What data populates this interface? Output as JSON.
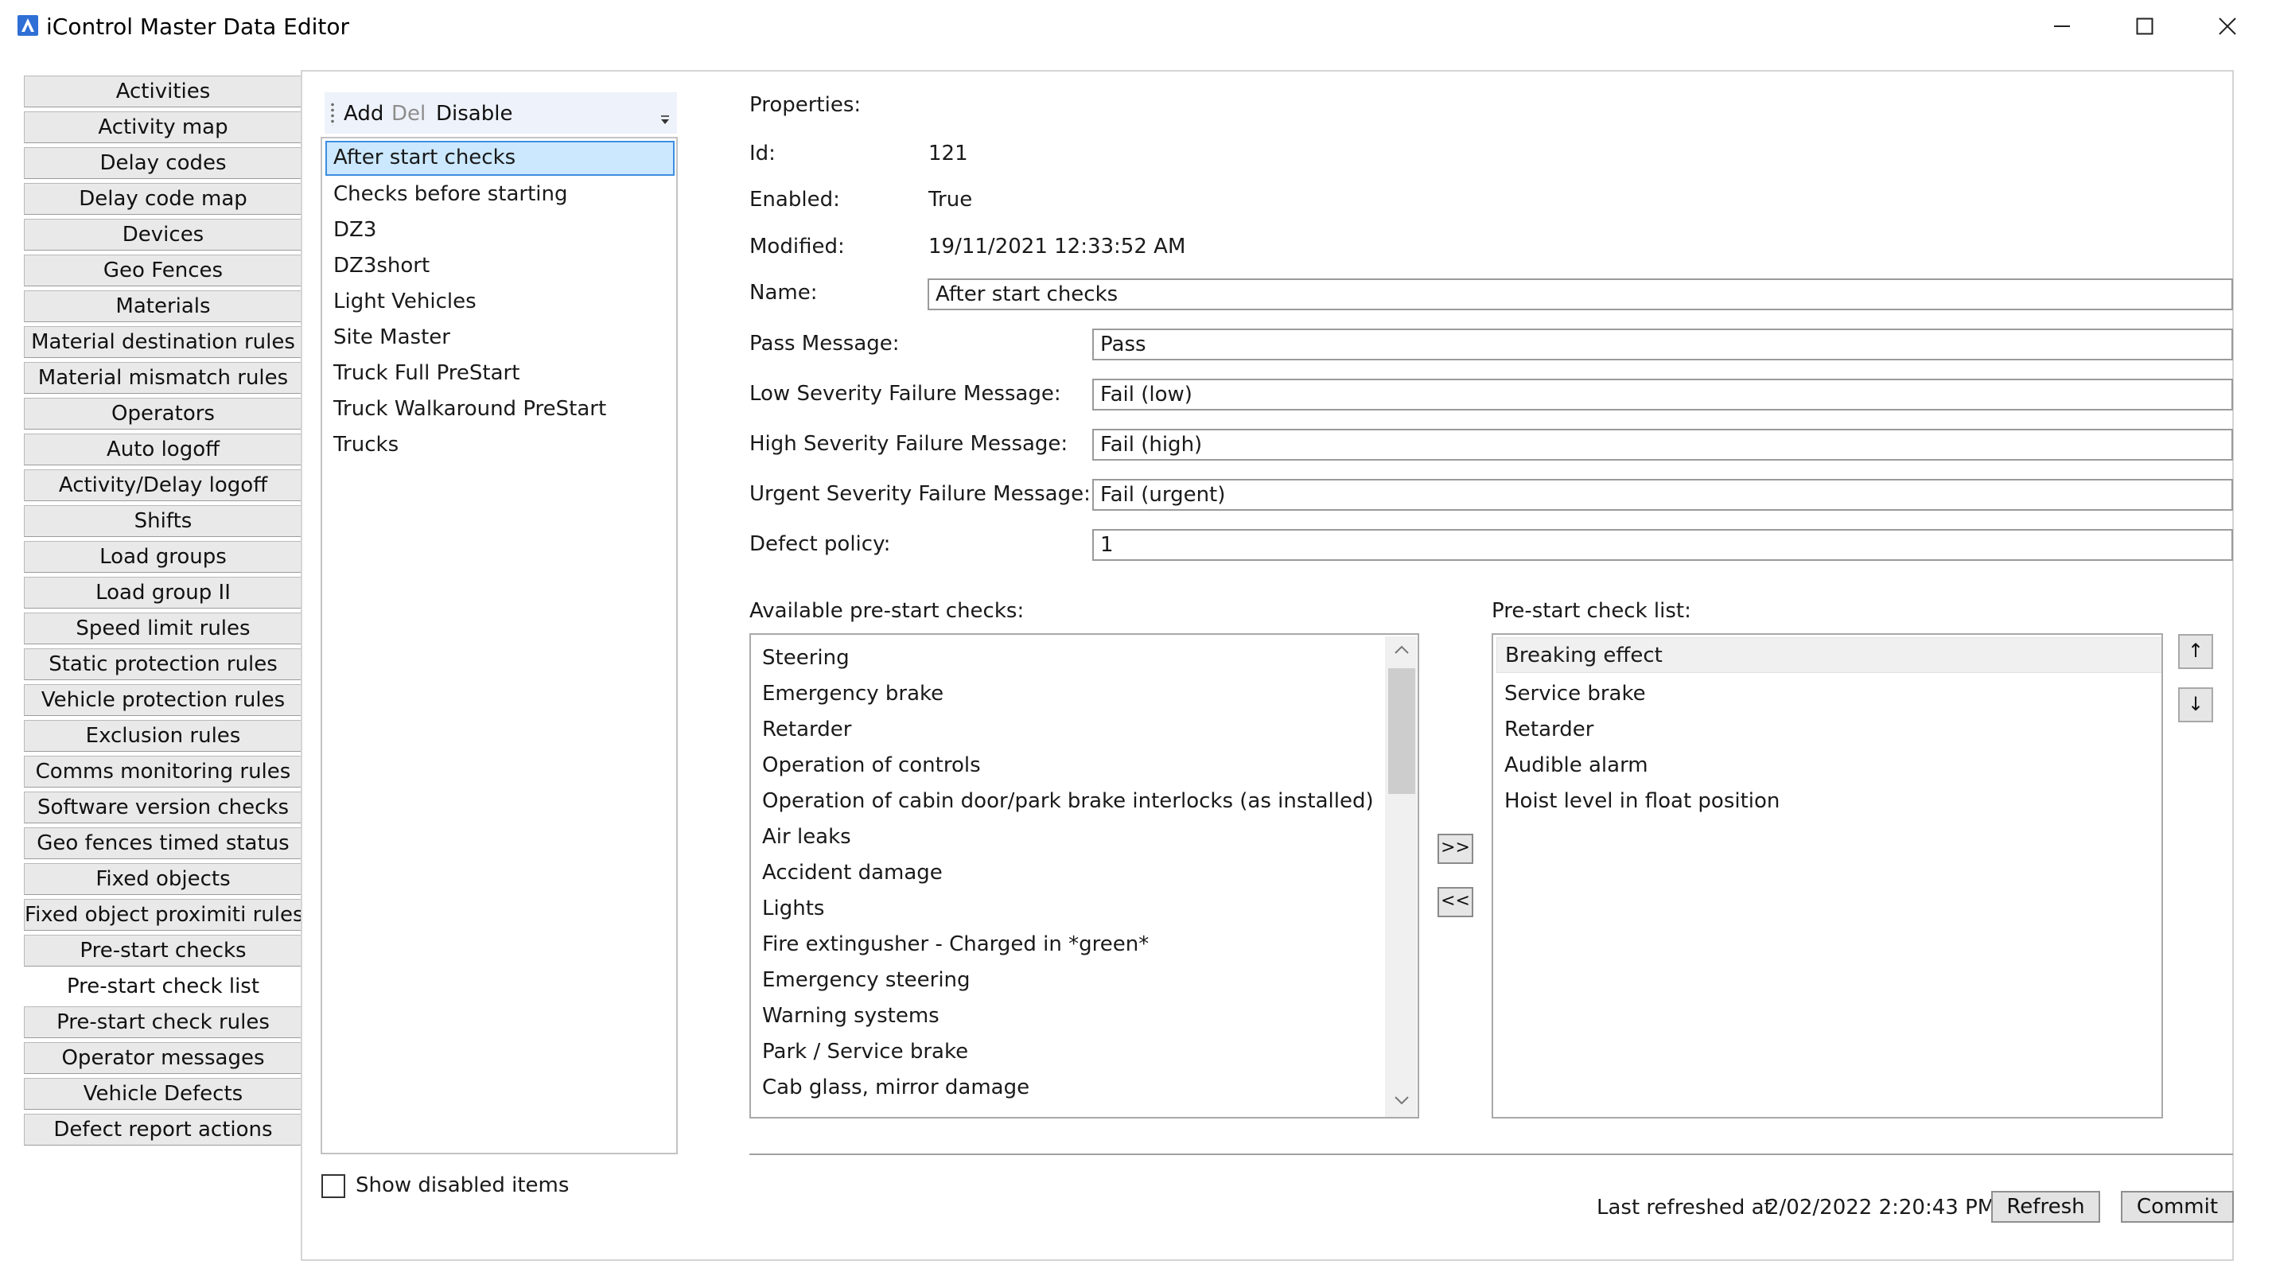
{
  "window": {
    "title": "iControl Master Data Editor",
    "icon": "app-logo-icon",
    "controls": [
      "minimize-icon",
      "maximize-icon",
      "close-icon"
    ]
  },
  "nav": {
    "items": [
      "Activities",
      "Activity map",
      "Delay codes",
      "Delay code map",
      "Devices",
      "Geo Fences",
      "Materials",
      "Material destination rules",
      "Material mismatch rules",
      "Operators",
      "Auto logoff",
      "Activity/Delay logoff",
      "Shifts",
      "Load groups",
      "Load group II",
      "Speed limit rules",
      "Static protection rules",
      "Vehicle protection rules",
      "Exclusion rules",
      "Comms monitoring rules",
      "Software version checks",
      "Geo fences timed status",
      "Fixed objects",
      "Fixed object proximiti rules",
      "Pre-start checks",
      "Pre-start check list",
      "Pre-start check rules",
      "Operator messages",
      "Vehicle Defects",
      "Defect report actions"
    ],
    "active": "Pre-start check list"
  },
  "toolbar": {
    "add": "Add",
    "del": "Del",
    "disable": "Disable"
  },
  "list": {
    "items": [
      "After start checks",
      "Checks before starting",
      "DZ3",
      "DZ3short",
      "Light Vehicles",
      "Site Master",
      "Truck Full PreStart",
      "Truck Walkaround PreStart",
      "Trucks"
    ],
    "selected": "After start checks"
  },
  "show_disabled": {
    "label": "Show disabled items",
    "checked": false
  },
  "properties": {
    "header": "Properties:",
    "id_label": "Id:",
    "id": "121",
    "enabled_label": "Enabled:",
    "enabled": "True",
    "modified_label": "Modified:",
    "modified": "19/11/2021 12:33:52 AM",
    "name_label": "Name:",
    "name": "After start checks",
    "pass_label": "Pass Message:",
    "pass": "Pass",
    "low_label": "Low Severity Failure Message:",
    "low": "Fail (low)",
    "high_label": "High Severity Failure Message:",
    "high": "Fail (high)",
    "urgent_label": "Urgent Severity Failure Message:",
    "urgent": "Fail (urgent)",
    "defect_label": "Defect policy:",
    "defect": "1"
  },
  "available": {
    "label": "Available pre-start checks:",
    "items": [
      "Steering",
      "Emergency brake",
      "Retarder",
      "Operation of controls",
      "Operation of cabin door/park brake interlocks (as installed)",
      "Air leaks",
      "Accident damage",
      "Lights",
      "Fire extingusher - Charged in *green*",
      "Emergency steering",
      "Warning systems",
      "Park / Service brake",
      "Cab glass, mirror damage"
    ]
  },
  "checklist": {
    "label": "Pre-start check list:",
    "items": [
      "Breaking effect",
      "Service brake",
      "Retarder",
      "Audible alarm",
      "Hoist level in float position"
    ],
    "selected": "Breaking effect"
  },
  "buttons": {
    "add_to_list": ">>",
    "remove_from_list": "<<",
    "move_up": "↑",
    "move_down": "↓",
    "refresh": "Refresh",
    "commit": "Commit"
  },
  "status": {
    "label": "Last refreshed at",
    "value": "2/02/2022 2:20:43 PM"
  }
}
